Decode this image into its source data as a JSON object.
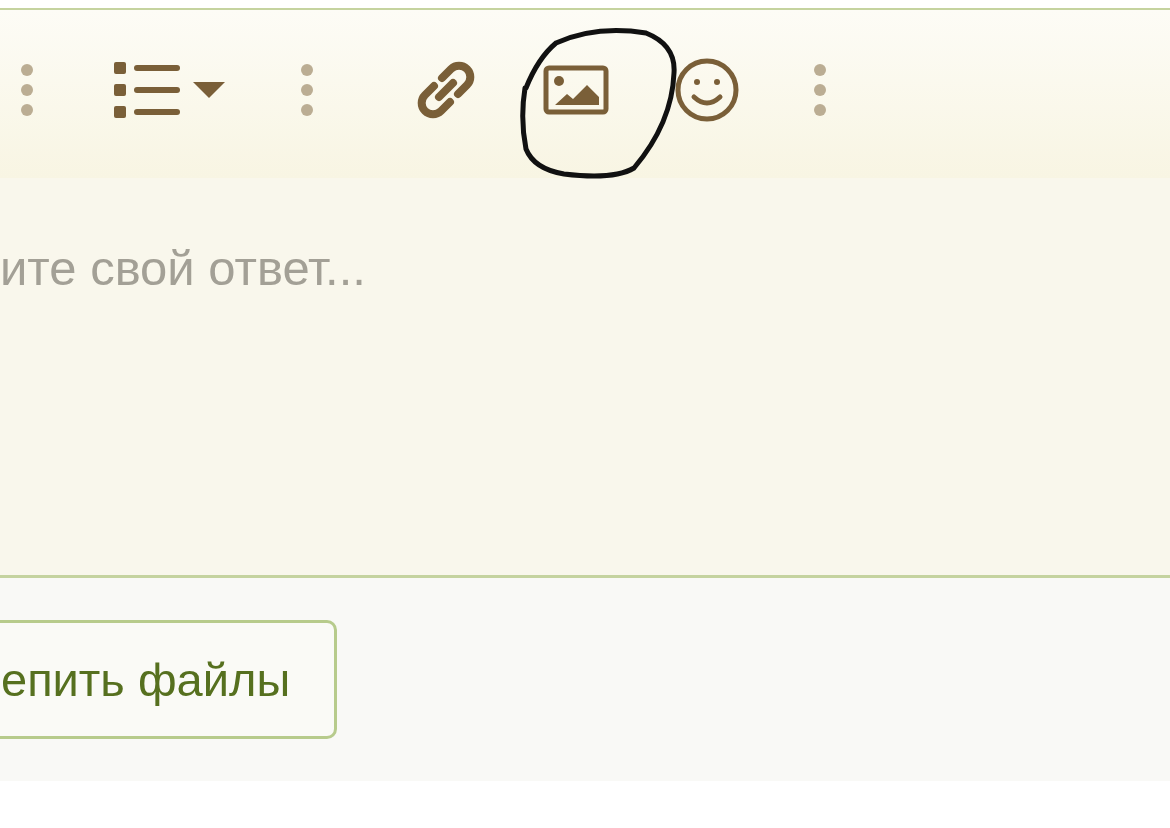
{
  "toolbar": [
    {
      "kind": "separator"
    },
    {
      "kind": "list"
    },
    {
      "kind": "separator"
    },
    {
      "kind": "link"
    },
    {
      "kind": "image"
    },
    {
      "kind": "emoji"
    },
    {
      "kind": "separator"
    }
  ],
  "annotation": {
    "kind": "circle"
  },
  "editor": {
    "placeholder": "ите свой ответ..."
  },
  "attach_button": {
    "label": "епить файлы"
  }
}
